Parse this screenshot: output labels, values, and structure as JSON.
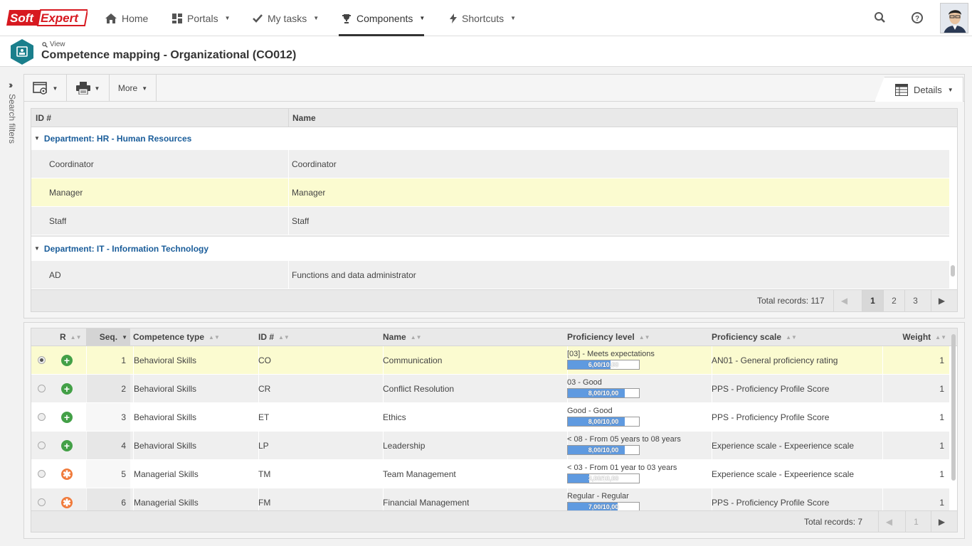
{
  "logo": {
    "part1": "Soft",
    "part2": "Expert"
  },
  "nav": {
    "home": "Home",
    "portals": "Portals",
    "my_tasks": "My tasks",
    "components": "Components",
    "shortcuts": "Shortcuts"
  },
  "header": {
    "breadcrumb": "View",
    "title": "Competence mapping - Organizational (CO012)"
  },
  "search_filters": "Search filters",
  "toolbar": {
    "more": "More",
    "details": "Details"
  },
  "grid1": {
    "columns": [
      "ID #",
      "Name"
    ],
    "groups": [
      {
        "label": "Department: HR - Human Resources",
        "rows": [
          {
            "id": "Coordinator",
            "name": "Coordinator"
          },
          {
            "id": "Manager",
            "name": "Manager"
          },
          {
            "id": "Staff",
            "name": "Staff"
          }
        ]
      },
      {
        "label": "Department: IT - Information Technology",
        "rows": [
          {
            "id": "AD",
            "name": "Functions and data administrator"
          }
        ]
      }
    ],
    "total": "Total records: 117",
    "pages": [
      "1",
      "2",
      "3"
    ]
  },
  "grid2": {
    "columns": {
      "r": "R",
      "seq": "Seq.",
      "type": "Competence type",
      "id": "ID #",
      "name": "Name",
      "level": "Proficiency level",
      "scale": "Proficiency scale",
      "weight": "Weight"
    },
    "rows": [
      {
        "seq": "1",
        "type": "Behavioral Skills",
        "id": "CO",
        "name": "Communication",
        "level": "[03] - Meets expectations",
        "bar": "6,00/10,00",
        "fill": 0.6,
        "scale": "AN01 - General proficiency rating",
        "weight": "1",
        "icon": "plus-icon",
        "color": "#43a047"
      },
      {
        "seq": "2",
        "type": "Behavioral Skills",
        "id": "CR",
        "name": "Conflict Resolution",
        "level": "03 - Good",
        "bar": "8,00/10,00",
        "fill": 0.8,
        "scale": "PPS - Proficiency Profile Score",
        "weight": "1",
        "icon": "plus-icon",
        "color": "#43a047"
      },
      {
        "seq": "3",
        "type": "Behavioral Skills",
        "id": "ET",
        "name": "Ethics",
        "level": "Good - Good",
        "bar": "8,00/10,00",
        "fill": 0.8,
        "scale": "PPS - Proficiency Profile Score",
        "weight": "1",
        "icon": "plus-icon",
        "color": "#43a047"
      },
      {
        "seq": "4",
        "type": "Behavioral Skills",
        "id": "LP",
        "name": "Leadership",
        "level": "< 08 - From 05 years to 08 years",
        "bar": "8,00/10,00",
        "fill": 0.8,
        "scale": "Experience scale - Expeerience scale",
        "weight": "1",
        "icon": "plus-icon",
        "color": "#43a047"
      },
      {
        "seq": "5",
        "type": "Managerial Skills",
        "id": "TM",
        "name": "Team Management",
        "level": "< 03 - From 01 year to 03 years",
        "bar": "3,00/10,00",
        "fill": 0.3,
        "scale": "Experience scale - Expeerience scale",
        "weight": "1",
        "icon": "asterisk-icon",
        "color": "#f07a3a"
      },
      {
        "seq": "6",
        "type": "Managerial Skills",
        "id": "FM",
        "name": "Financial Management",
        "level": "Regular - Regular",
        "bar": "7,00/10,00",
        "fill": 0.7,
        "scale": "PPS - Proficiency Profile Score",
        "weight": "1",
        "icon": "asterisk-icon",
        "color": "#f07a3a"
      }
    ],
    "total": "Total records: 7",
    "page": "1"
  }
}
